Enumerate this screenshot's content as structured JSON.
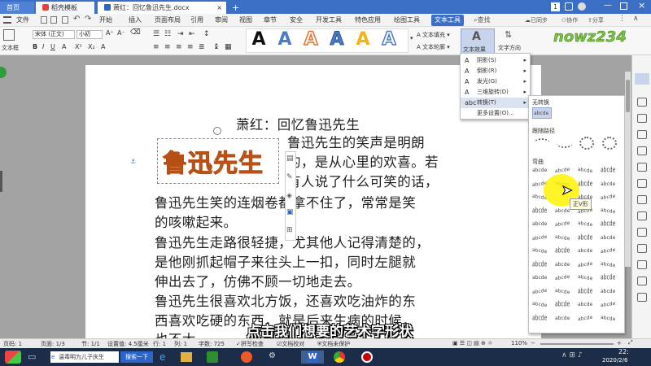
{
  "titlebar": {
    "tabs": [
      "首页",
      "稻壳模板",
      "萧红：回忆鲁迅先生.docx"
    ],
    "page_counter": "1"
  },
  "menubar": {
    "file_label": "文件",
    "items": [
      "开始",
      "插入",
      "页面布局",
      "引用",
      "审阅",
      "视图",
      "章节",
      "安全",
      "开发工具",
      "特色应用",
      "绘图工具",
      "文本工具"
    ],
    "search_label": "查找",
    "sync_label": "已同步",
    "collab_label": "协作",
    "share_label": "分享"
  },
  "ribbon": {
    "textbox_label": "文本框",
    "font_name": "宋体 (正文)",
    "font_size": "小初",
    "text_fill_label": "文本填充",
    "text_outline_label": "文本轮廓",
    "text_effects_label": "文本效果",
    "text_direction_label": "文字方向",
    "watermark_logo": "nowz234"
  },
  "effects_menu": {
    "items": [
      {
        "label": "阴影(S)",
        "icon": "shadow-icon"
      },
      {
        "label": "倒影(R)",
        "icon": "reflection-icon"
      },
      {
        "label": "发光(G)",
        "icon": "glow-icon"
      },
      {
        "label": "三维旋转(D)",
        "icon": "3d-rotation-icon"
      },
      {
        "label": "转换(T)",
        "icon": "transform-icon"
      },
      {
        "label": "更多设置(O)...",
        "icon": ""
      }
    ]
  },
  "transform_panel": {
    "no_transform_label": "无转换",
    "follow_path_label": "跟随路径",
    "warp_label": "弯曲",
    "tooltip": "正V形",
    "sample_text": "abcde",
    "sample_text_short": "abc"
  },
  "document": {
    "title": "萧红：回忆鲁迅先生",
    "art_text": "鲁迅先生",
    "lines": [
      "鲁迅先生的笑声是明朗",
      "的，是从心里的欢喜。若",
      "有人说了什么可笑的话，",
      "鲁迅先生笑的连烟卷都拿不住了，常常是笑",
      "的咳嗽起来。",
      "鲁迅先生走路很轻捷，尤其他人记得清楚的，",
      "是他刚抓起帽子来往头上一扣，同时左腿就",
      "伸出去了，仿佛不顾一切地走去。",
      "鲁迅先生很喜欢北方饭，还喜欢吃油炸的东",
      "西喜欢吃硬的东西，就是后来生病的时候，",
      "也不大"
    ]
  },
  "statusbar": {
    "page": "页码: 1",
    "pages": "页面: 1/3",
    "section": "节: 1/1",
    "setting": "设置值: 4.5厘米",
    "row": "行: 1",
    "col": "列: 1",
    "words": "字数: 725",
    "spellcheck": "拼写检查",
    "doc_proof": "文档校对",
    "doc_protect": "文档未保护",
    "zoom": "110%"
  },
  "taskbar": {
    "search_tab": "温毒明为儿子庆生",
    "search_button": "搜索一下",
    "time": "22:",
    "date": "2020/2/6"
  },
  "caption": "点击我们想要的艺术字形状",
  "colors": {
    "title_blue": "#3b6fc6",
    "art_orange": "#e66f2a",
    "caption_white": "#ffffff",
    "taskbar": "#1b2d48"
  }
}
